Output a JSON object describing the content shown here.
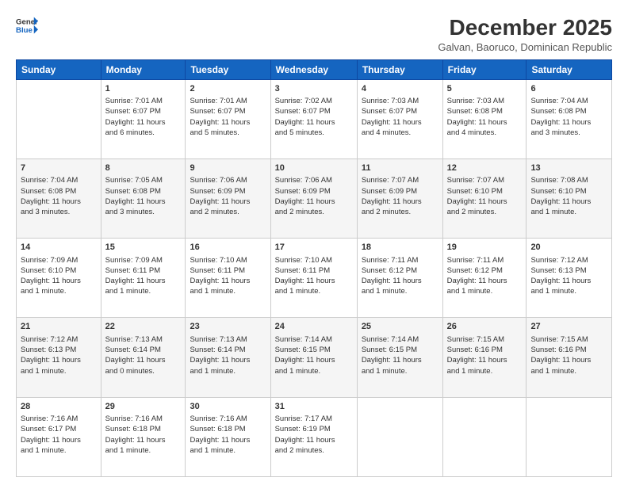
{
  "logo": {
    "line1": "General",
    "line2": "Blue"
  },
  "title": "December 2025",
  "subtitle": "Galvan, Baoruco, Dominican Republic",
  "days_header": [
    "Sunday",
    "Monday",
    "Tuesday",
    "Wednesday",
    "Thursday",
    "Friday",
    "Saturday"
  ],
  "weeks": [
    [
      {
        "num": "",
        "info": ""
      },
      {
        "num": "1",
        "info": "Sunrise: 7:01 AM\nSunset: 6:07 PM\nDaylight: 11 hours\nand 6 minutes."
      },
      {
        "num": "2",
        "info": "Sunrise: 7:01 AM\nSunset: 6:07 PM\nDaylight: 11 hours\nand 5 minutes."
      },
      {
        "num": "3",
        "info": "Sunrise: 7:02 AM\nSunset: 6:07 PM\nDaylight: 11 hours\nand 5 minutes."
      },
      {
        "num": "4",
        "info": "Sunrise: 7:03 AM\nSunset: 6:07 PM\nDaylight: 11 hours\nand 4 minutes."
      },
      {
        "num": "5",
        "info": "Sunrise: 7:03 AM\nSunset: 6:08 PM\nDaylight: 11 hours\nand 4 minutes."
      },
      {
        "num": "6",
        "info": "Sunrise: 7:04 AM\nSunset: 6:08 PM\nDaylight: 11 hours\nand 3 minutes."
      }
    ],
    [
      {
        "num": "7",
        "info": "Sunrise: 7:04 AM\nSunset: 6:08 PM\nDaylight: 11 hours\nand 3 minutes."
      },
      {
        "num": "8",
        "info": "Sunrise: 7:05 AM\nSunset: 6:08 PM\nDaylight: 11 hours\nand 3 minutes."
      },
      {
        "num": "9",
        "info": "Sunrise: 7:06 AM\nSunset: 6:09 PM\nDaylight: 11 hours\nand 2 minutes."
      },
      {
        "num": "10",
        "info": "Sunrise: 7:06 AM\nSunset: 6:09 PM\nDaylight: 11 hours\nand 2 minutes."
      },
      {
        "num": "11",
        "info": "Sunrise: 7:07 AM\nSunset: 6:09 PM\nDaylight: 11 hours\nand 2 minutes."
      },
      {
        "num": "12",
        "info": "Sunrise: 7:07 AM\nSunset: 6:10 PM\nDaylight: 11 hours\nand 2 minutes."
      },
      {
        "num": "13",
        "info": "Sunrise: 7:08 AM\nSunset: 6:10 PM\nDaylight: 11 hours\nand 1 minute."
      }
    ],
    [
      {
        "num": "14",
        "info": "Sunrise: 7:09 AM\nSunset: 6:10 PM\nDaylight: 11 hours\nand 1 minute."
      },
      {
        "num": "15",
        "info": "Sunrise: 7:09 AM\nSunset: 6:11 PM\nDaylight: 11 hours\nand 1 minute."
      },
      {
        "num": "16",
        "info": "Sunrise: 7:10 AM\nSunset: 6:11 PM\nDaylight: 11 hours\nand 1 minute."
      },
      {
        "num": "17",
        "info": "Sunrise: 7:10 AM\nSunset: 6:11 PM\nDaylight: 11 hours\nand 1 minute."
      },
      {
        "num": "18",
        "info": "Sunrise: 7:11 AM\nSunset: 6:12 PM\nDaylight: 11 hours\nand 1 minute."
      },
      {
        "num": "19",
        "info": "Sunrise: 7:11 AM\nSunset: 6:12 PM\nDaylight: 11 hours\nand 1 minute."
      },
      {
        "num": "20",
        "info": "Sunrise: 7:12 AM\nSunset: 6:13 PM\nDaylight: 11 hours\nand 1 minute."
      }
    ],
    [
      {
        "num": "21",
        "info": "Sunrise: 7:12 AM\nSunset: 6:13 PM\nDaylight: 11 hours\nand 1 minute."
      },
      {
        "num": "22",
        "info": "Sunrise: 7:13 AM\nSunset: 6:14 PM\nDaylight: 11 hours\nand 0 minutes."
      },
      {
        "num": "23",
        "info": "Sunrise: 7:13 AM\nSunset: 6:14 PM\nDaylight: 11 hours\nand 1 minute."
      },
      {
        "num": "24",
        "info": "Sunrise: 7:14 AM\nSunset: 6:15 PM\nDaylight: 11 hours\nand 1 minute."
      },
      {
        "num": "25",
        "info": "Sunrise: 7:14 AM\nSunset: 6:15 PM\nDaylight: 11 hours\nand 1 minute."
      },
      {
        "num": "26",
        "info": "Sunrise: 7:15 AM\nSunset: 6:16 PM\nDaylight: 11 hours\nand 1 minute."
      },
      {
        "num": "27",
        "info": "Sunrise: 7:15 AM\nSunset: 6:16 PM\nDaylight: 11 hours\nand 1 minute."
      }
    ],
    [
      {
        "num": "28",
        "info": "Sunrise: 7:16 AM\nSunset: 6:17 PM\nDaylight: 11 hours\nand 1 minute."
      },
      {
        "num": "29",
        "info": "Sunrise: 7:16 AM\nSunset: 6:18 PM\nDaylight: 11 hours\nand 1 minute."
      },
      {
        "num": "30",
        "info": "Sunrise: 7:16 AM\nSunset: 6:18 PM\nDaylight: 11 hours\nand 1 minute."
      },
      {
        "num": "31",
        "info": "Sunrise: 7:17 AM\nSunset: 6:19 PM\nDaylight: 11 hours\nand 2 minutes."
      },
      {
        "num": "",
        "info": ""
      },
      {
        "num": "",
        "info": ""
      },
      {
        "num": "",
        "info": ""
      }
    ]
  ]
}
